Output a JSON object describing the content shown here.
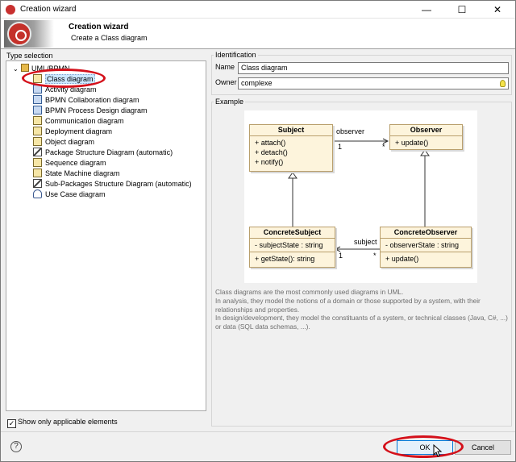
{
  "window": {
    "title": "Creation wizard",
    "controls": {
      "minimize": "—",
      "maximize": "☐",
      "close": "✕"
    }
  },
  "header": {
    "title": "Creation wizard",
    "subtitle": "Create a Class diagram"
  },
  "type_selection": {
    "label": "Type selection",
    "root": "UML/BPMN",
    "items": [
      {
        "label": "Class diagram",
        "icon": "class-diagram-icon",
        "selected": true
      },
      {
        "label": "Activity diagram",
        "icon": "activity-diagram-icon"
      },
      {
        "label": "BPMN Collaboration diagram",
        "icon": "bpmn-collaboration-icon"
      },
      {
        "label": "BPMN Process Design diagram",
        "icon": "bpmn-process-icon"
      },
      {
        "label": "Communication diagram",
        "icon": "communication-diagram-icon"
      },
      {
        "label": "Deployment diagram",
        "icon": "deployment-diagram-icon"
      },
      {
        "label": "Object diagram",
        "icon": "object-diagram-icon"
      },
      {
        "label": "Package Structure Diagram (automatic)",
        "icon": "package-structure-icon"
      },
      {
        "label": "Sequence diagram",
        "icon": "sequence-diagram-icon"
      },
      {
        "label": "State Machine diagram",
        "icon": "state-machine-icon"
      },
      {
        "label": "Sub-Packages Structure Diagram (automatic)",
        "icon": "sub-packages-icon"
      },
      {
        "label": "Use Case diagram",
        "icon": "use-case-icon"
      }
    ],
    "show_applicable_label": "Show only applicable elements",
    "show_applicable_checked": true,
    "check_mark": "✓"
  },
  "identification": {
    "label": "Identification",
    "name_label": "Name",
    "name_value": "Class diagram",
    "owner_label": "Owner",
    "owner_value": "complexe"
  },
  "example": {
    "label": "Example",
    "subject": {
      "name": "Subject",
      "ops": [
        "+ attach()",
        "+ detach()",
        "+ notify()"
      ]
    },
    "observer": {
      "name": "Observer",
      "ops": [
        "+ update()"
      ]
    },
    "concrete_subject": {
      "name": "ConcreteSubject",
      "attrs": [
        "- subjectState : string"
      ],
      "ops": [
        "+ getState(): string"
      ]
    },
    "concrete_observer": {
      "name": "ConcreteObserver",
      "attrs": [
        "- observerState : string"
      ],
      "ops": [
        "+ update()"
      ]
    },
    "assoc_top": {
      "role": "observer",
      "mult_left": "1",
      "mult_right": "*"
    },
    "assoc_bottom": {
      "role": "subject",
      "mult_left": "1",
      "mult_right": "*"
    },
    "description": [
      "Class diagrams are the most commonly used diagrams in UML.",
      "In analysis, they model the notions of a domain or those supported by a system, with their relationships and properties.",
      "In design/development, they model the constituants of a system, or technical classes (Java, C#, ...) or data (SQL data schemas, ...)."
    ]
  },
  "buttons": {
    "help": "?",
    "ok": "OK",
    "cancel": "Cancel"
  },
  "colors": {
    "highlight": "#d4101a",
    "uml_fill": "#fdf4dc",
    "selection": "#cce8ff"
  }
}
